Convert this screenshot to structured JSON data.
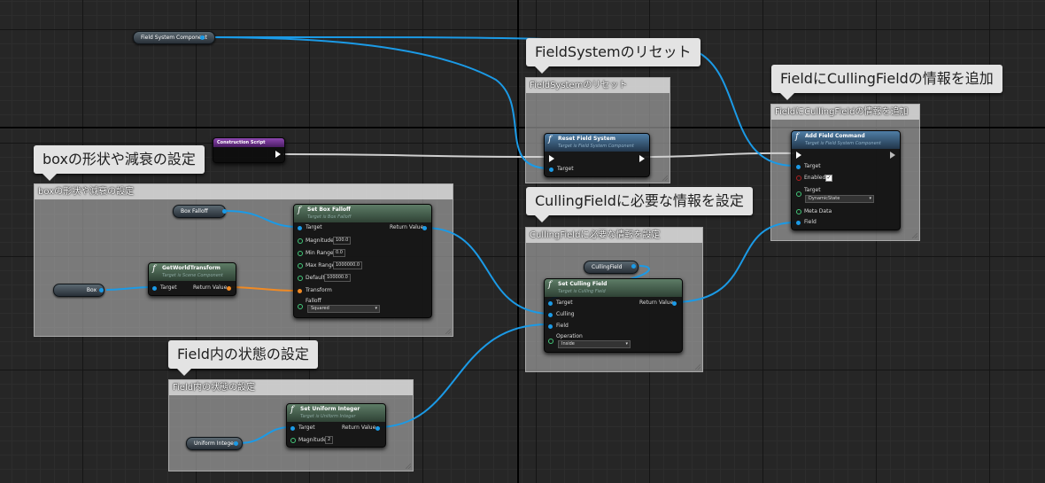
{
  "comments": {
    "field_system_reset": "FieldSystemのリセット",
    "field_culling_info": "FieldにCullingFieldの情報を追加",
    "box_shape": "boxの形状や減衰の設定",
    "culling_required": "CullingFieldに必要な情報を設定",
    "field_state": "Field内の状態の設定"
  },
  "variables": {
    "field_system_component": "Field System Component",
    "box_falloff": "Box Falloff",
    "box": "Box",
    "culling_field": "CullingField",
    "uniform_integer": "Uniform Integer"
  },
  "construction_script": {
    "title": "Construction Script"
  },
  "reset_field_system": {
    "title": "Reset Field System",
    "subtitle": "Target is Field System Component",
    "pin_target": "Target"
  },
  "add_field_command": {
    "title": "Add Field Command",
    "subtitle": "Target is Field System Component",
    "pin_target": "Target",
    "pin_enabled": "Enabled",
    "pin_target2": "Target",
    "target_value": "DynamicState",
    "pin_meta_data": "Meta Data",
    "pin_field": "Field"
  },
  "set_box_falloff": {
    "title": "Set Box Falloff",
    "subtitle": "Target is Box Falloff",
    "pin_target": "Target",
    "pin_return": "Return Value",
    "pin_magnitude": "Magnitude",
    "magnitude": "100.0",
    "pin_min_range": "Min Range",
    "min_range": "0.0",
    "pin_max_range": "Max Range",
    "max_range": "1000000.0",
    "pin_default": "Default",
    "default": "100000.0",
    "pin_transform": "Transform",
    "pin_falloff": "Falloff",
    "falloff": "Squared"
  },
  "get_world_transform": {
    "title": "GetWorldTransform",
    "subtitle": "Target is Scene Component",
    "pin_target": "Target",
    "pin_return": "Return Value"
  },
  "set_culling_field": {
    "title": "Set Culling Field",
    "subtitle": "Target is Culling Field",
    "pin_target": "Target",
    "pin_return": "Return Value",
    "pin_culling": "Culling",
    "pin_field": "Field",
    "pin_operation": "Operation",
    "operation": "Inside"
  },
  "set_uniform_integer": {
    "title": "Set Uniform Integer",
    "subtitle": "Target is Uniform Integer",
    "pin_target": "Target",
    "pin_return": "Return Value",
    "pin_magnitude": "Magnitude",
    "magnitude": "2"
  },
  "colors": {
    "object_pin": "#1b9ae6",
    "transform_pin": "#f08a24",
    "exec_wire": "#ffffff",
    "comment_bg": "#afafaf",
    "bubble_bg": "#e3e3e3"
  }
}
